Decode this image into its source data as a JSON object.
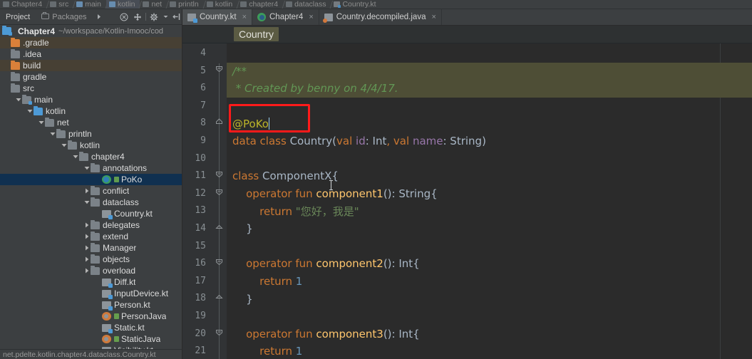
{
  "window": {
    "ide": "IntelliJ IDEA",
    "nav_breadcrumbs": [
      {
        "label": "Chapter4",
        "icon": "module-icon",
        "selected": false
      },
      {
        "label": "src",
        "icon": "folder-icon",
        "selected": false
      },
      {
        "label": "main",
        "icon": "source-folder-icon",
        "selected": false
      },
      {
        "label": "kotlin",
        "icon": "source-folder-icon",
        "selected": true
      },
      {
        "label": "net",
        "icon": "folder-icon",
        "selected": false
      },
      {
        "label": "println",
        "icon": "folder-icon",
        "selected": false
      },
      {
        "label": "kotlin",
        "icon": "folder-icon",
        "selected": false
      },
      {
        "label": "chapter4",
        "icon": "folder-icon",
        "selected": false
      },
      {
        "label": "dataclass",
        "icon": "folder-icon",
        "selected": false
      },
      {
        "label": "Country.kt",
        "icon": "kotlin-file-icon",
        "selected": false
      }
    ]
  },
  "project_panel": {
    "tool_tabs": [
      {
        "label": "Project",
        "active": true,
        "icon": "project-icon"
      },
      {
        "label": "Packages",
        "active": false,
        "icon": "packages-icon"
      }
    ],
    "toolbar_buttons": [
      {
        "name": "expand-arrow-button",
        "icon": "chevron-right-icon"
      },
      {
        "name": "collapse-all-button",
        "icon": "collapse-circle-icon"
      },
      {
        "name": "expand-all-button",
        "icon": "expand-cross-icon"
      },
      {
        "name": "settings-button",
        "icon": "gear-icon"
      },
      {
        "name": "hide-panel-button",
        "icon": "hide-left-icon"
      }
    ],
    "root": {
      "name": "Chapter4",
      "path": "~/workspace/Kotlin-Imooc/cod"
    },
    "tree": [
      {
        "label": ".gradle",
        "depth": 0,
        "arrow": "none",
        "icon": "folder-orange-icon",
        "state": "highlight"
      },
      {
        "label": ".idea",
        "depth": 0,
        "arrow": "none",
        "icon": "folder-icon",
        "state": "normal"
      },
      {
        "label": "build",
        "depth": 0,
        "arrow": "none",
        "icon": "folder-orange-icon",
        "state": "highlight"
      },
      {
        "label": "gradle",
        "depth": 0,
        "arrow": "none",
        "icon": "folder-icon",
        "state": "normal"
      },
      {
        "label": "src",
        "depth": 0,
        "arrow": "none",
        "icon": "folder-icon",
        "state": "normal"
      },
      {
        "label": "main",
        "depth": 1,
        "arrow": "expanded",
        "icon": "source-folder-icon",
        "state": "normal"
      },
      {
        "label": "kotlin",
        "depth": 2,
        "arrow": "expanded",
        "icon": "folder-blue-icon",
        "state": "normal"
      },
      {
        "label": "net",
        "depth": 3,
        "arrow": "expanded",
        "icon": "package-icon",
        "state": "normal"
      },
      {
        "label": "println",
        "depth": 4,
        "arrow": "expanded",
        "icon": "package-icon",
        "state": "normal"
      },
      {
        "label": "kotlin",
        "depth": 5,
        "arrow": "expanded",
        "icon": "package-icon",
        "state": "normal"
      },
      {
        "label": "chapter4",
        "depth": 6,
        "arrow": "expanded",
        "icon": "package-icon",
        "state": "normal"
      },
      {
        "label": "annotations",
        "depth": 7,
        "arrow": "expanded",
        "icon": "package-icon",
        "state": "normal"
      },
      {
        "label": "PoKo",
        "depth": 8,
        "arrow": "none",
        "icon": "kotlin-class-icon",
        "state": "selected"
      },
      {
        "label": "conflict",
        "depth": 7,
        "arrow": "collapsed",
        "icon": "package-icon",
        "state": "normal"
      },
      {
        "label": "dataclass",
        "depth": 7,
        "arrow": "expanded",
        "icon": "package-icon",
        "state": "normal"
      },
      {
        "label": "Country.kt",
        "depth": 8,
        "arrow": "none",
        "icon": "kotlin-file-icon",
        "state": "normal"
      },
      {
        "label": "delegates",
        "depth": 7,
        "arrow": "collapsed",
        "icon": "package-icon",
        "state": "normal"
      },
      {
        "label": "extend",
        "depth": 7,
        "arrow": "collapsed",
        "icon": "package-icon",
        "state": "normal"
      },
      {
        "label": "Manager",
        "depth": 7,
        "arrow": "collapsed",
        "icon": "package-icon",
        "state": "normal"
      },
      {
        "label": "objects",
        "depth": 7,
        "arrow": "collapsed",
        "icon": "package-icon",
        "state": "normal"
      },
      {
        "label": "overload",
        "depth": 7,
        "arrow": "collapsed",
        "icon": "package-icon",
        "state": "normal"
      },
      {
        "label": "Diff.kt",
        "depth": 8,
        "arrow": "none",
        "icon": "kotlin-file-icon",
        "state": "normal"
      },
      {
        "label": "InputDevice.kt",
        "depth": 8,
        "arrow": "none",
        "icon": "kotlin-file-icon",
        "state": "normal"
      },
      {
        "label": "Person.kt",
        "depth": 8,
        "arrow": "none",
        "icon": "kotlin-file-icon",
        "state": "normal"
      },
      {
        "label": "PersonJava",
        "depth": 8,
        "arrow": "none",
        "icon": "java-class-icon",
        "state": "normal"
      },
      {
        "label": "Static.kt",
        "depth": 8,
        "arrow": "none",
        "icon": "kotlin-file-icon",
        "state": "normal"
      },
      {
        "label": "StaticJava",
        "depth": 8,
        "arrow": "none",
        "icon": "java-class-icon",
        "state": "normal"
      },
      {
        "label": "Visibility.kt",
        "depth": 8,
        "arrow": "none",
        "icon": "kotlin-file-icon",
        "state": "normal"
      }
    ],
    "status_path": "net.pdelte.kotlin.chapter4.dataclass.Country.kt"
  },
  "editor": {
    "tabs": [
      {
        "label": "Country.kt",
        "icon": "kotlin-file-icon",
        "active": true,
        "close": "×"
      },
      {
        "label": "Chapter4",
        "icon": "module-green-icon",
        "active": false,
        "close": "×"
      },
      {
        "label": "Country.decompiled.java",
        "icon": "java-file-icon",
        "active": false,
        "close": "×"
      }
    ],
    "breadcrumb": "Country",
    "first_line_number": 4,
    "line_numbers": [
      4,
      5,
      6,
      7,
      8,
      9,
      10,
      11,
      12,
      13,
      14,
      15,
      16,
      17,
      18,
      19,
      20,
      21
    ],
    "lines": [
      {
        "n": 4,
        "segments": []
      },
      {
        "n": 5,
        "doc": true,
        "segments": [
          {
            "t": "/**",
            "c": "c-doc"
          }
        ]
      },
      {
        "n": 6,
        "doc": true,
        "segments": [
          {
            "t": " * Created by benny on 4/4/17.",
            "c": "c-doc"
          }
        ]
      },
      {
        "n": 7,
        "segments": []
      },
      {
        "n": 8,
        "segments": [
          {
            "t": "@PoKo",
            "c": "c-ann"
          }
        ],
        "caret": true
      },
      {
        "n": 9,
        "segments": [
          {
            "t": "data class ",
            "c": "c-kw"
          },
          {
            "t": "Country",
            "c": "c-type"
          },
          {
            "t": "(",
            "c": "c-punc"
          },
          {
            "t": "val ",
            "c": "c-kw"
          },
          {
            "t": "id",
            "c": "c-param"
          },
          {
            "t": ": Int",
            "c": "c-type"
          },
          {
            "t": ", ",
            "c": "c-kw"
          },
          {
            "t": "val ",
            "c": "c-kw"
          },
          {
            "t": "name",
            "c": "c-param"
          },
          {
            "t": ": String)",
            "c": "c-type"
          }
        ]
      },
      {
        "n": 10,
        "segments": []
      },
      {
        "n": 11,
        "segments": [
          {
            "t": "class ",
            "c": "c-kw"
          },
          {
            "t": "ComponentX{",
            "c": "c-type"
          }
        ]
      },
      {
        "n": 12,
        "segments": [
          {
            "t": "    ",
            "c": "c-plain"
          },
          {
            "t": "operator fun ",
            "c": "c-kw"
          },
          {
            "t": "component1",
            "c": "c-fn"
          },
          {
            "t": "(): String{",
            "c": "c-type"
          }
        ]
      },
      {
        "n": 13,
        "segments": [
          {
            "t": "        ",
            "c": "c-plain"
          },
          {
            "t": "return ",
            "c": "c-kw"
          },
          {
            "t": "\"您好，我是\"",
            "c": "c-str"
          }
        ]
      },
      {
        "n": 14,
        "segments": [
          {
            "t": "    }",
            "c": "c-plain"
          }
        ]
      },
      {
        "n": 15,
        "segments": []
      },
      {
        "n": 16,
        "segments": [
          {
            "t": "    ",
            "c": "c-plain"
          },
          {
            "t": "operator fun ",
            "c": "c-kw"
          },
          {
            "t": "component2",
            "c": "c-fn"
          },
          {
            "t": "(): Int{",
            "c": "c-type"
          }
        ]
      },
      {
        "n": 17,
        "segments": [
          {
            "t": "        ",
            "c": "c-plain"
          },
          {
            "t": "return ",
            "c": "c-kw"
          },
          {
            "t": "1",
            "c": "c-num"
          }
        ]
      },
      {
        "n": 18,
        "segments": [
          {
            "t": "    }",
            "c": "c-plain"
          }
        ]
      },
      {
        "n": 19,
        "segments": []
      },
      {
        "n": 20,
        "segments": [
          {
            "t": "    ",
            "c": "c-plain"
          },
          {
            "t": "operator fun ",
            "c": "c-kw"
          },
          {
            "t": "component3",
            "c": "c-fn"
          },
          {
            "t": "(): Int{",
            "c": "c-type"
          }
        ]
      },
      {
        "n": 21,
        "segments": [
          {
            "t": "        ",
            "c": "c-plain"
          },
          {
            "t": "return ",
            "c": "c-kw"
          },
          {
            "t": "1",
            "c": "c-num"
          }
        ]
      }
    ],
    "intention_bulb": {
      "name": "intention-bulb-icon",
      "line": 7
    },
    "annotation_box": {
      "color": "#ff1a1a",
      "target": "@PoKo"
    }
  },
  "colors": {
    "panel_bg": "#3c3f41",
    "editor_bg": "#2b2b2b",
    "gutter_bg": "#313335",
    "selection_blue": "#103050",
    "doc_highlight": "#4e4e36",
    "breadcrumb_chip": "#5b5b43",
    "annotation_red": "#ff1a1a",
    "keyword_orange": "#cc7832",
    "string_green": "#6a8759",
    "number_blue": "#6897bb",
    "function_yellow": "#ffc66d",
    "annotation_yellow": "#bbb529",
    "doc_green": "#629755",
    "param_purple": "#9876aa"
  }
}
